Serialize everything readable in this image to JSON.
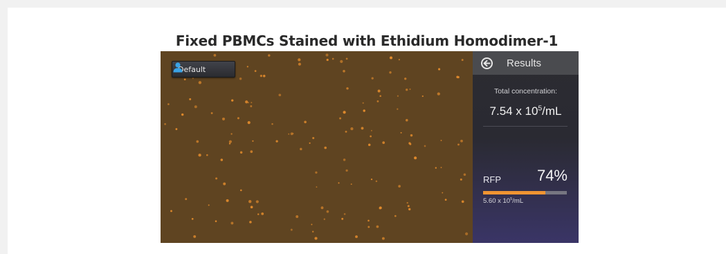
{
  "title": "Fixed PBMCs Stained with Ethidium Homodimer-1",
  "viewer": {
    "profile_label": "Default",
    "profile_icon": "user-icon",
    "background_color": "#5f4421",
    "cell_color": "#e08a2c"
  },
  "results": {
    "back_icon": "arrow-left-circle-icon",
    "header": "Results",
    "total_label": "Total concentration:",
    "total_mantissa": "7.54 x 10",
    "total_exponent": "5",
    "total_unit": "/mL",
    "channel": {
      "name": "RFP",
      "percent_label": "74%",
      "percent_value": 0.74,
      "conc_mantissa": "5.60 x 10",
      "conc_exponent": "5",
      "conc_unit": "/mL",
      "bar_color": "#f09432"
    }
  }
}
